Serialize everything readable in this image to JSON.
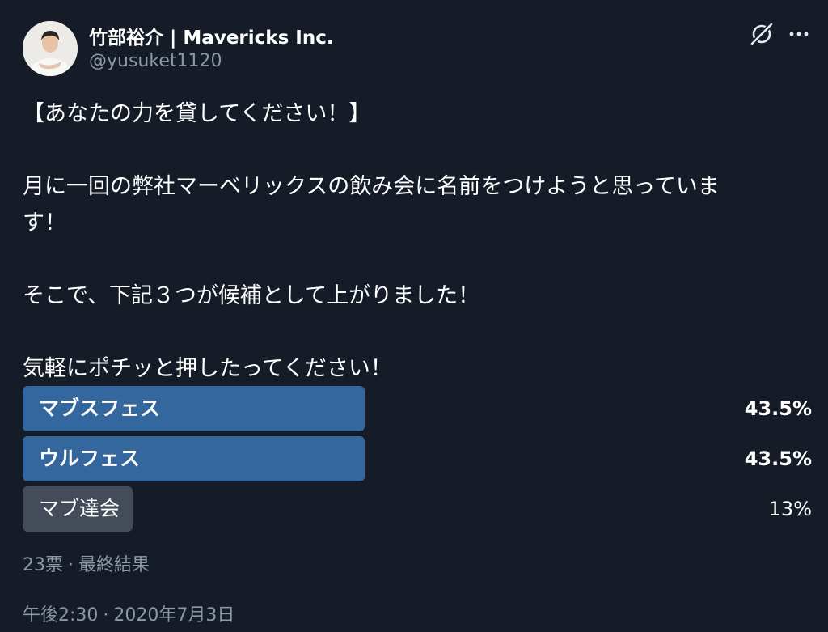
{
  "tweet": {
    "author_name": "竹部裕介 | Mavericks Inc.",
    "handle": "@yusuket1120",
    "icons": {
      "grok": "grok-slash-icon",
      "more": "more-options-icon"
    },
    "lines": [
      "【あなたの力を貸してください！】",
      "",
      "月に一回の弊社マーベリックスの飲み会に名前をつけようと思っていま",
      "す！",
      "",
      "そこで、下記３つが候補として上がりました！",
      "",
      "気軽にポチッと押したってください！"
    ]
  },
  "poll": {
    "options": [
      {
        "label": "マブスフェス",
        "percent_text": "43.5%",
        "share": 0.435,
        "winner": true
      },
      {
        "label": "ウルフェス",
        "percent_text": "43.5%",
        "share": 0.435,
        "winner": true
      },
      {
        "label": "マブ達会",
        "percent_text": "13%",
        "share": 0.13,
        "winner": false
      }
    ],
    "votes": "23票",
    "status": "最終結果",
    "separator": "·"
  },
  "footer": {
    "time": "午後2:30",
    "date": "2020年7月3日",
    "separator": "·"
  },
  "colors": {
    "background": "#151c28",
    "winner_bar": "#33679d",
    "other_bar": "#434c58",
    "muted_text": "#8b98a5"
  }
}
